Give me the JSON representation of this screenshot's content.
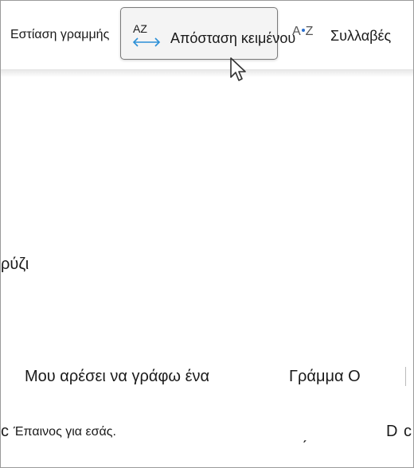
{
  "toolbar": {
    "line_focus_label": "Εστίαση γραμμής",
    "text_spacing_icon_text": "AZ",
    "text_spacing_label": "Απόσταση κειμένου",
    "syllables_icon_left": "A",
    "syllables_icon_right": "Z",
    "syllables_label": "Συλλαβές",
    "accent_color": "#2b8fd6"
  },
  "document": {
    "word_rice_fragment": "ρύζι",
    "line_i_like": "Μου αρέσει να γράφω ένα",
    "line_letter_o": "Γράμμα Ο",
    "praise_prefix": "c",
    "praise_text": "Έπαινος για εσάς.",
    "tone_mark": "ˏ",
    "letter_d": "D",
    "letter_c_edge": "c"
  }
}
